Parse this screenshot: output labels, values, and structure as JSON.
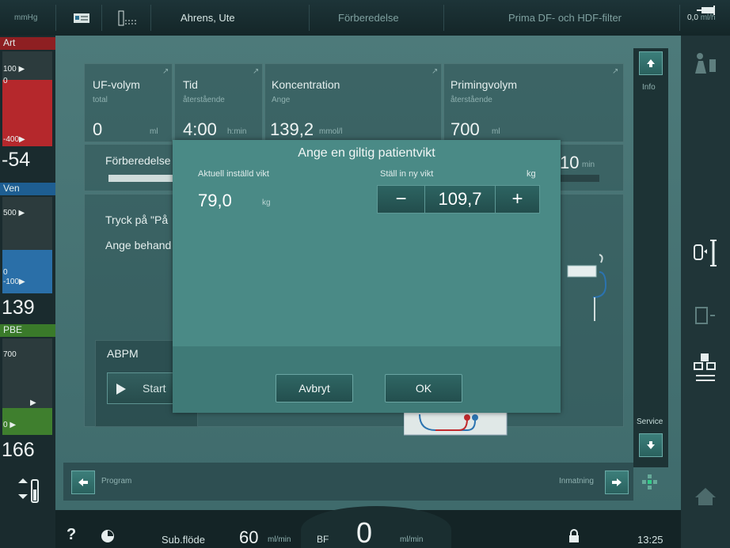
{
  "topbar": {
    "unit": "mmHg",
    "patient": "Ahrens, Ute",
    "phase": "Förberedelse",
    "filter": "Prima DF- och HDF-filter",
    "rate": "0,0",
    "rate_unit": "ml/h"
  },
  "left": {
    "art_label": "Art",
    "art_top": "100 ▶",
    "art_zero": "0",
    "art_bottom": "-400▶",
    "art_value": "-54",
    "ven_label": "Ven",
    "ven_top": "500 ▶",
    "ven_zero": "0",
    "ven_bottom": "-100▶",
    "ven_value": "139",
    "pbe_label": "PBE",
    "pbe_top": "700",
    "pbe_mark": "▶",
    "pbe_zero": "0  ▶",
    "pbe_value": "166",
    "colors": {
      "art": "#b5282c",
      "ven": "#2a6fa8",
      "pbe": "#3f7f2e"
    }
  },
  "cards": [
    {
      "title": "UF-volym",
      "sub": "total",
      "value": "0",
      "unit": "ml"
    },
    {
      "title": "Tid",
      "sub": "återstående",
      "value": "4:00",
      "unit": "h:min"
    },
    {
      "title": "Koncentration",
      "sub": "Ange",
      "value": "139,2",
      "unit": "mmol/l"
    },
    {
      "title": "Primingvolym",
      "sub": "återstående",
      "value": "700",
      "unit": "ml"
    }
  ],
  "info_label": "Info",
  "prep_label": "Förberedelse",
  "prep_time": "10",
  "prep_time_unit": "min",
  "instruction1": "Tryck på \"På",
  "instruction2": "Ange behand",
  "abpm_label": "ABPM",
  "start_label": "Start",
  "service_label": "Service",
  "nav": {
    "program": "Program",
    "inmatning": "Inmatning"
  },
  "bottom": {
    "help": "?",
    "subflow_label": "Sub.flöde",
    "subflow_value": "60",
    "subflow_unit": "ml/min",
    "bf_label": "BF",
    "bf_value": "0",
    "bf_unit": "ml/min",
    "clock": "13:25"
  },
  "modal": {
    "title": "Ange en giltig patientvikt",
    "current_label": "Aktuell inställd vikt",
    "current_value": "79,0",
    "current_unit": "kg",
    "new_label": "Ställ in ny vikt",
    "new_unit": "kg",
    "new_value": "109,7",
    "minus": "−",
    "plus": "+",
    "cancel": "Avbryt",
    "ok": "OK"
  }
}
